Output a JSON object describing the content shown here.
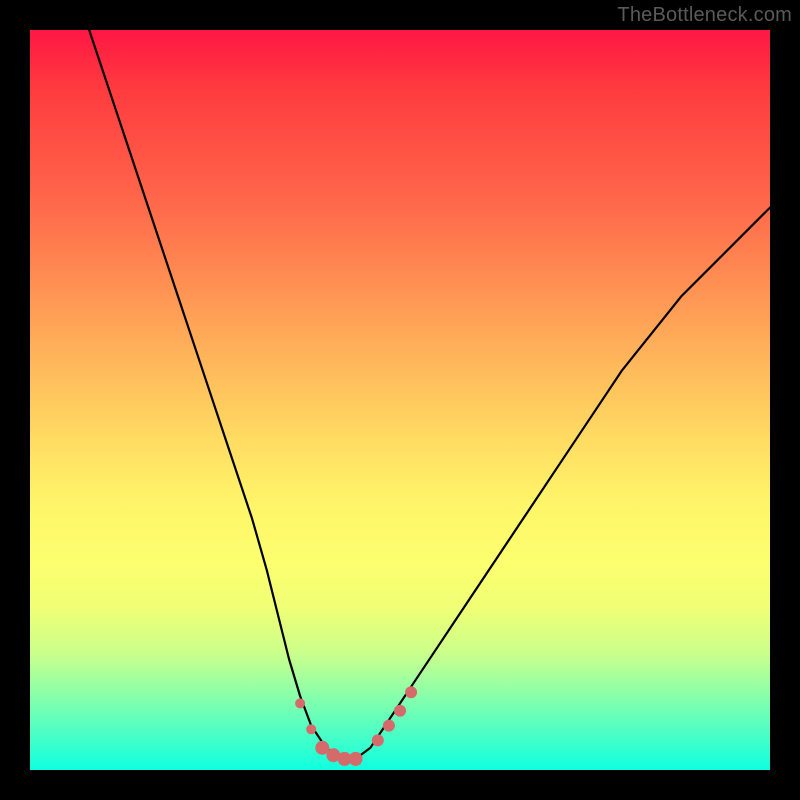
{
  "watermark": "TheBottleneck.com",
  "chart_data": {
    "type": "line",
    "title": "",
    "xlabel": "",
    "ylabel": "",
    "x_range": [
      0,
      100
    ],
    "y_range": [
      0,
      100
    ],
    "gradient_stops": [
      {
        "pos": 0,
        "color": "#ff1744"
      },
      {
        "pos": 50,
        "color": "#ffd85c"
      },
      {
        "pos": 78,
        "color": "#f0ff75"
      },
      {
        "pos": 100,
        "color": "#10ffe0"
      }
    ],
    "series": [
      {
        "name": "bottleneck-curve",
        "x": [
          8,
          10,
          12,
          14,
          16,
          18,
          20,
          22,
          24,
          26,
          28,
          30,
          32,
          33.5,
          35,
          36.5,
          38,
          40,
          42,
          44,
          46,
          48,
          52,
          56,
          60,
          64,
          68,
          72,
          76,
          80,
          84,
          88,
          92,
          96,
          100
        ],
        "y": [
          100,
          94,
          88,
          82,
          76,
          70,
          64,
          58,
          52,
          46,
          40,
          34,
          27,
          21,
          15,
          10,
          6,
          3,
          1.5,
          1.5,
          3,
          6,
          12,
          18,
          24,
          30,
          36,
          42,
          48,
          54,
          59,
          64,
          68,
          72,
          76
        ]
      }
    ],
    "markers": {
      "left_cluster": {
        "x": [
          36.5,
          38,
          39.5,
          41,
          42.5,
          44
        ],
        "y": [
          9,
          5.5,
          3,
          2,
          1.5,
          1.5
        ]
      },
      "right_cluster": {
        "x": [
          47,
          48.5,
          50,
          51.5
        ],
        "y": [
          4,
          6,
          8,
          10.5
        ]
      },
      "radius_main": 7,
      "radius_small": 5
    }
  }
}
